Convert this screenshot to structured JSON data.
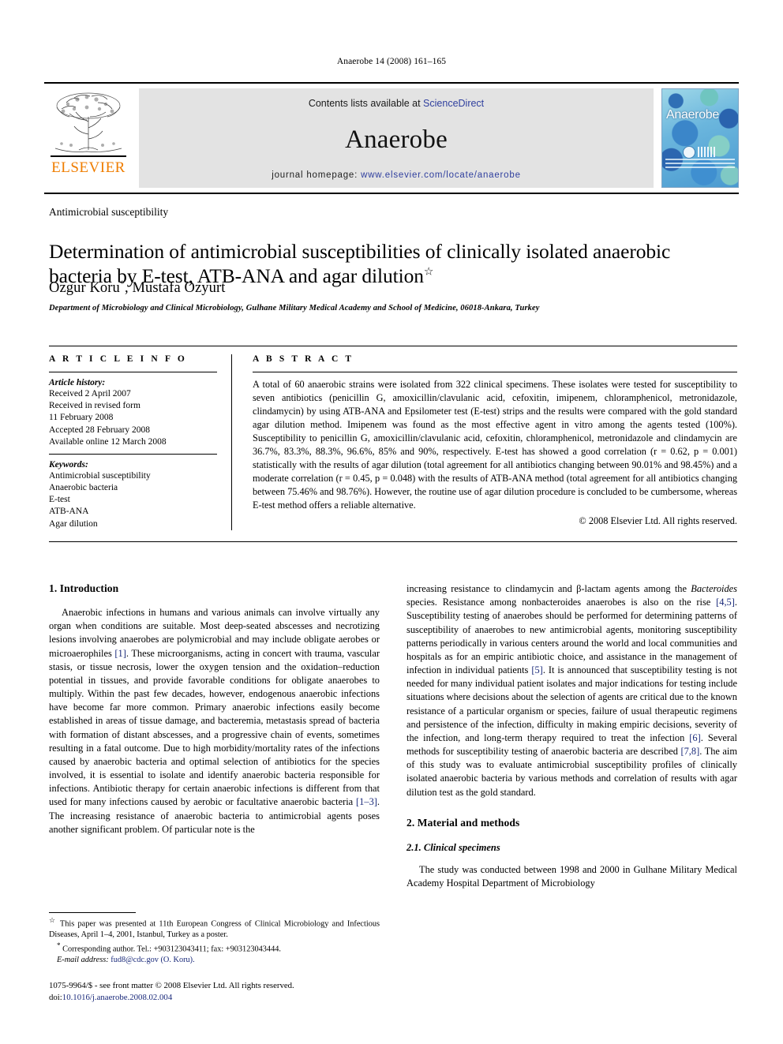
{
  "running_head": "Anaerobe 14 (2008) 161–165",
  "masthead": {
    "publisher_name": "ELSEVIER",
    "publisher_icon": "elsevier-tree-logo",
    "contents_prefix": "Contents lists available at ",
    "contents_link": "ScienceDirect",
    "journal_name": "Anaerobe",
    "homepage_prefix": "journal homepage: ",
    "homepage_url": "www.elsevier.com/locate/anaerobe",
    "cover_title": "Anaerobe",
    "colors": {
      "band_background": "#e3e3e3",
      "link_blue": "#2f3f9e",
      "elsevier_orange": "#ef7d00"
    }
  },
  "article": {
    "section_label": "Antimicrobial susceptibility",
    "title": "Determination of antimicrobial susceptibilities of clinically isolated anaerobic bacteria by E-test, ATB-ANA and agar dilution",
    "title_footnote_symbol": "☆",
    "authors": "Ozgur Koru",
    "author_footnote_symbol": "*",
    "authors_rest": ", Mustafa Ozyurt",
    "affiliation": "Department of Microbiology and Clinical Microbiology, Gulhane Military Medical Academy and School of Medicine, 06018-Ankara, Turkey"
  },
  "article_info": {
    "heading": "A R T I C L E   I N F O",
    "history_label": "Article history:",
    "history": [
      "Received 2 April 2007",
      "Received in revised form",
      "11 February 2008",
      "Accepted 28 February 2008",
      "Available online 12 March 2008"
    ],
    "keywords_label": "Keywords:",
    "keywords": [
      "Antimicrobial susceptibility",
      "Anaerobic bacteria",
      "E-test",
      "ATB-ANA",
      "Agar dilution"
    ]
  },
  "abstract": {
    "heading": "A B S T R A C T",
    "text": "A total of 60 anaerobic strains were isolated from 322 clinical specimens. These isolates were tested for susceptibility to seven antibiotics (penicillin G, amoxicillin/clavulanic acid, cefoxitin, imipenem, chloramphenicol, metronidazole, clindamycin) by using ATB-ANA and Epsilometer test (E-test) strips and the results were compared with the gold standard agar dilution method. Imipenem was found as the most effective agent in vitro among the agents tested (100%). Susceptibility to penicillin G, amoxicillin/clavulanic acid, cefoxitin, chloramphenicol, metronidazole and clindamycin are 36.7%, 83.3%, 88.3%, 96.6%, 85% and 90%, respectively. E-test has showed a good correlation (r = 0.62, p = 0.001) statistically with the results of agar dilution (total agreement for all antibiotics changing between 90.01% and 98.45%) and a moderate correlation (r = 0.45, p = 0.048) with the results of ATB-ANA method (total agreement for all antibiotics changing between 75.46% and 98.76%). However, the routine use of agar dilution procedure is concluded to be cumbersome, whereas E-test method offers a reliable alternative.",
    "copyright": "© 2008 Elsevier Ltd. All rights reserved."
  },
  "body": {
    "intro_heading": "1.  Introduction",
    "intro_p1_a": "Anaerobic infections in humans and various animals can involve virtually any organ when conditions are suitable. Most deep-seated abscesses and necrotizing lesions involving anaerobes are polymicrobial and may include obligate aerobes or microaerophiles ",
    "ref1": "[1]",
    "intro_p1_b": ". These microorganisms, acting in concert with trauma, vascular stasis, or tissue necrosis, lower the oxygen tension and the oxidation–reduction potential in tissues, and provide favorable conditions for obligate anaerobes to multiply. Within the past few decades, however, endogenous anaerobic infections have become far more common. Primary anaerobic infections easily become established in areas of tissue damage, and bacteremia, metastasis spread of bacteria with formation of distant abscesses, and a progressive chain of events, sometimes resulting in a fatal outcome. Due to high morbidity/mortality rates of the infections caused by anaerobic bacteria and optimal selection of antibiotics for the species involved, it is essential to isolate and identify anaerobic bacteria responsible for infections. Antibiotic therapy for certain anaerobic infections is different from that used for many infections caused by aerobic or facultative anaerobic bacteria ",
    "ref1_3": "[1–3]",
    "intro_p1_c": ". The increasing resistance of anaerobic bacteria to antimicrobial agents poses another significant problem. Of particular note is the increasing resistance to clindamycin and β-lactam agents among the ",
    "bacteroides": "Bacteroides",
    "intro_p1_d": " species. Resistance among nonbacteroides anaerobes is also on the rise ",
    "ref4_5": "[4,5]",
    "intro_p1_e": ". Susceptibility testing of anaerobes should be performed for determining patterns of susceptibility of anaerobes to new antimicrobial agents, monitoring susceptibility patterns periodically in various centers around the world and local communities and hospitals as for an empiric antibiotic choice, and assistance in the management of infection in individual patients ",
    "ref5": "[5]",
    "intro_p1_f": ". It is announced that susceptibility testing is not needed for many individual patient isolates and major indications for testing include situations where decisions about the selection of agents are critical due to the known resistance of a particular organism or species, failure of usual therapeutic regimens and persistence of the infection, difficulty in making empiric decisions, severity of the infection, and long-term therapy required to treat the infection ",
    "ref6": "[6]",
    "intro_p1_g": ". Several methods for susceptibility testing of anaerobic bacteria are described ",
    "ref7_8": "[7,8]",
    "intro_p1_h": ". The aim of this study was to evaluate antimicrobial susceptibility profiles of clinically isolated anaerobic bacteria by various methods and correlation of results with agar dilution test as the gold standard.",
    "methods_heading": "2.  Material and methods",
    "methods_sub_heading": "2.1.  Clinical specimens",
    "methods_p1": "The study was conducted between 1998 and 2000 in Gulhane Military Medical Academy Hospital Department of Microbiology"
  },
  "footnotes": {
    "star_symbol": "☆",
    "star_text": "This paper was presented at 11th European Congress of Clinical Microbiology and Infectious Diseases, April 1–4, 2001, Istanbul, Turkey as a poster.",
    "corresponding_symbol": "*",
    "corresponding_text": "Corresponding author. Tel.: +903123043411; fax: +903123043444.",
    "email_label": "E-mail address:",
    "email_value": "fud8@cdc.gov (O. Koru).",
    "issn_line": "1075-9964/$ - see front matter © 2008 Elsevier Ltd. All rights reserved.",
    "doi_label": "doi:",
    "doi_value": "10.1016/j.anaerobe.2008.02.004"
  }
}
